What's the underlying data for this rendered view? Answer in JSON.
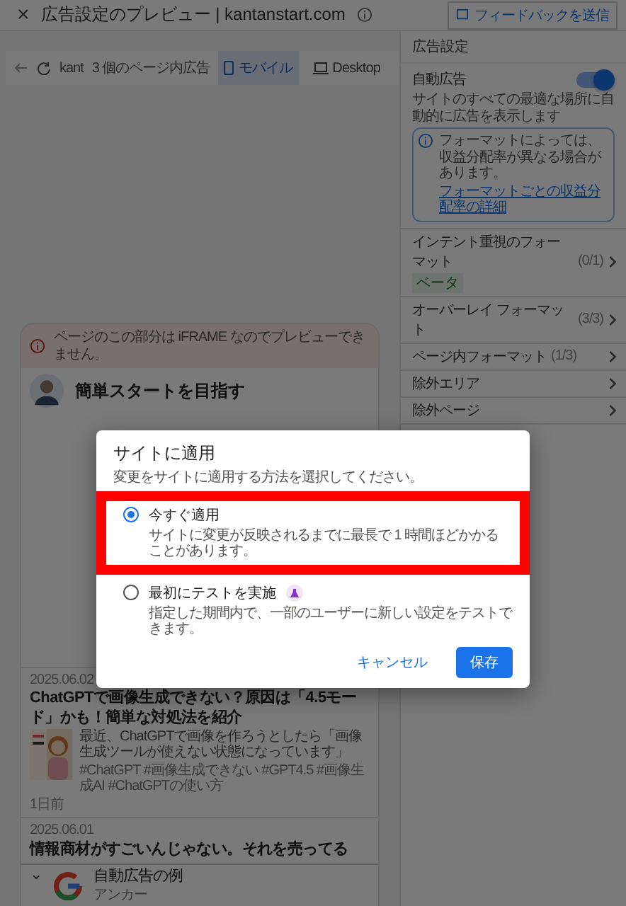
{
  "header": {
    "close": "×",
    "title": "広告設定のプレビュー | kantanstart.com",
    "feedback_button": "フィードバックを送信"
  },
  "toolbar": {
    "site": "kant",
    "ad_count": "3 個のページ内広告",
    "tabs": [
      {
        "label": "モバイル",
        "selected": true,
        "kind": "mobile"
      },
      {
        "label": "Desktop",
        "selected": false,
        "kind": "desktop"
      }
    ]
  },
  "settings": {
    "heading": "広告設定",
    "auto_ads": {
      "label": "自動広告",
      "on": true,
      "description": "サイトのすべての最適な場所に自動的に広告を表示します"
    },
    "info": {
      "text": "フォーマットによっては、収益分配率が異なる場合があります。",
      "link": "フォーマットごとの収益分配率の詳細"
    },
    "items": [
      {
        "label": "インテント重視のフォーマット",
        "badge": "ベータ",
        "count": "(0/1)"
      },
      {
        "label": "オーバーレイ フォーマット",
        "count": "(3/3)"
      },
      {
        "label": "ページ内フォーマット",
        "count": "(1/3)"
      },
      {
        "label": "除外エリア"
      },
      {
        "label": "除外ページ"
      }
    ]
  },
  "preview": {
    "error": "ページのこの部分は iFRAME なのでプレビューできません。",
    "profile": {
      "name": "簡単スタートを目指す"
    },
    "articles": [
      {
        "date": "2025.06.02",
        "title": "ChatGPTで画像生成できない？原因は「4.5モード」かも！簡単な対処法を紹介",
        "excerpt": "最近、ChatGPTで画像を作ろうとしたら「画像生成ツールが使えない状態になっています」",
        "tags": "#ChatGPT #画像生成できない #GPT4.5 #画像生成AI #ChatGPTの使い方",
        "age": "1日前"
      },
      {
        "date": "2025.06.01",
        "title": "情報商材がすごいんじゃない。それを売ってる"
      }
    ],
    "anchor_ad": {
      "collapse": "⌄",
      "title": "自動広告の例",
      "subtitle": "アンカー"
    }
  },
  "dialog": {
    "title": "サイトに適用",
    "subtitle": "変更をサイトに適用する方法を選択してください。",
    "options": [
      {
        "label": "今すぐ適用",
        "description": "サイトに変更が反映されるまでに最長で 1 時間ほどかかることがあります。",
        "selected": true,
        "highlighted": true
      },
      {
        "label": "最初にテストを実施",
        "description": "指定した期間内で、一部のユーザーに新しい設定をテストできます。",
        "selected": false,
        "highlighted": false,
        "badge": true
      }
    ],
    "buttons": [
      {
        "label": "キャンセル",
        "kind": "text"
      },
      {
        "label": "保存",
        "kind": "primary"
      }
    ]
  }
}
